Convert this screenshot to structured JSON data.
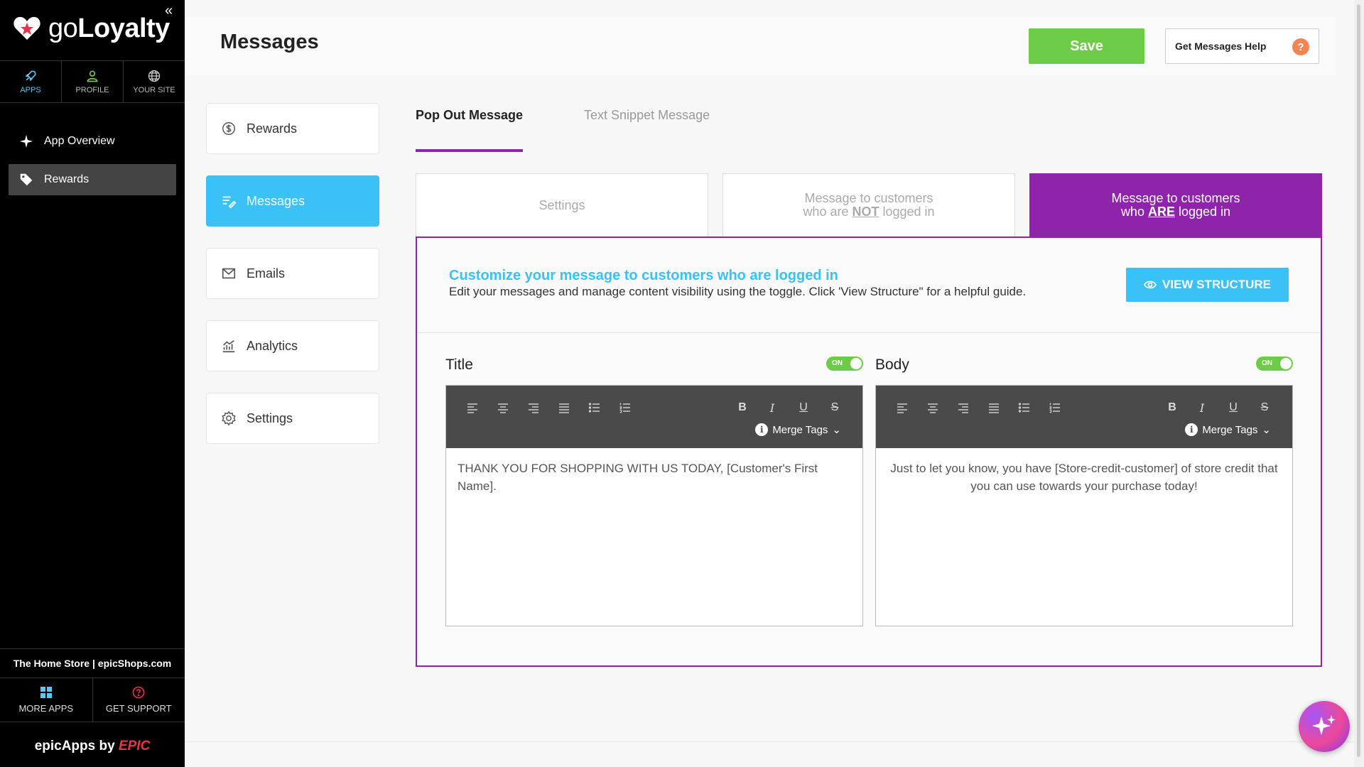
{
  "colors": {
    "accent_purple": "#8e24aa",
    "accent_blue": "#3ac1f5",
    "save_green": "#6dcc47",
    "sidebar_bg": "#000000"
  },
  "sidebar": {
    "logo": {
      "prefix": "go",
      "name": "Loyalty"
    },
    "topnav": [
      {
        "label": "APPS",
        "icon": "rocket-icon"
      },
      {
        "label": "PROFILE",
        "icon": "user-icon"
      },
      {
        "label": "YOUR SITE",
        "icon": "globe-icon"
      }
    ],
    "menu": [
      {
        "label": "App Overview",
        "icon": "sparkle-icon"
      },
      {
        "label": "Rewards",
        "icon": "tag-icon"
      }
    ],
    "store_name": "The Home Store | epicShops.com",
    "bottomnav": [
      {
        "label": "MORE APPS",
        "icon": "grid-icon"
      },
      {
        "label": "GET SUPPORT",
        "icon": "help-circle-icon"
      }
    ],
    "powered_by": "epicApps by",
    "powered_brand": "EPIC"
  },
  "header": {
    "title": "Messages",
    "save_label": "Save",
    "help_label": "Get Messages Help",
    "help_icon": "?"
  },
  "subnav": [
    {
      "label": "Rewards",
      "icon": "dollar-circle-icon"
    },
    {
      "label": "Messages",
      "icon": "edit-lines-icon"
    },
    {
      "label": "Emails",
      "icon": "mail-icon"
    },
    {
      "label": "Analytics",
      "icon": "chart-icon"
    },
    {
      "label": "Settings",
      "icon": "gear-icon"
    }
  ],
  "tabs": [
    {
      "label": "Pop Out Message"
    },
    {
      "label": "Text Snippet Message"
    }
  ],
  "subtabs": {
    "settings": "Settings",
    "not_logged": {
      "line1": "Message to customers",
      "pre": "who are ",
      "em": "NOT",
      "post": " logged in"
    },
    "logged": {
      "line1": "Message to customers",
      "pre": "who ",
      "em": "ARE",
      "post": " logged in"
    }
  },
  "panel": {
    "heading": "Customize your message to customers who are logged in",
    "subtext": "Edit your messages and manage content visibility using the toggle. Click 'View Structure\" for a helpful guide.",
    "view_button": "VIEW STRUCTURE"
  },
  "editors": {
    "title": {
      "label": "Title",
      "toggle": "ON",
      "merge_tags": "Merge Tags",
      "content": "THANK YOU FOR SHOPPING WITH US TODAY, [Customer's First Name]."
    },
    "body": {
      "label": "Body",
      "toggle": "ON",
      "merge_tags": "Merge Tags",
      "content": "Just to let you know, you have [Store-credit-customer] of store credit that you can use towards your purchase today!"
    }
  },
  "toolbar": {
    "bold": "B",
    "italic": "I",
    "underline": "U",
    "strike": "S"
  }
}
